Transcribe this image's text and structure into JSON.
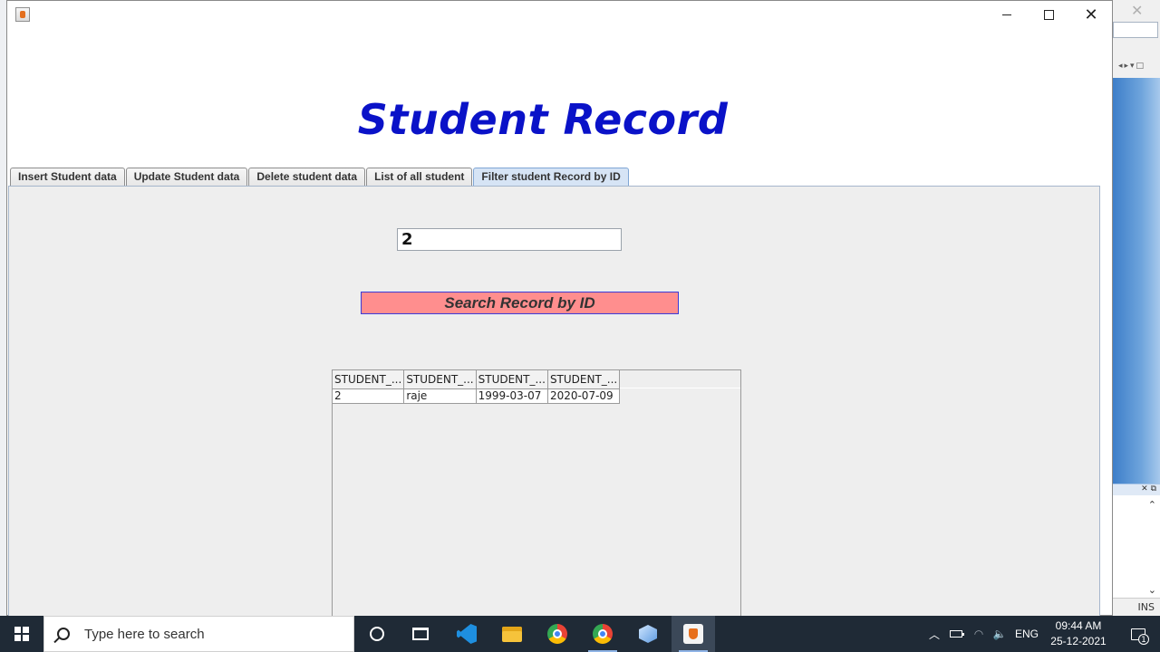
{
  "window": {
    "heading": "Student Record",
    "controls": {
      "minimize": "minimize",
      "maximize": "maximize",
      "close": "close"
    }
  },
  "tabs": [
    {
      "label": "Insert Student data",
      "active": false
    },
    {
      "label": "Update Student data",
      "active": false
    },
    {
      "label": "Delete student data",
      "active": false
    },
    {
      "label": "List of all student",
      "active": false
    },
    {
      "label": "Filter student Record by ID",
      "active": true
    }
  ],
  "filter_panel": {
    "id_input_value": "2",
    "search_button_label": "Search Record by ID",
    "search_button_color": "#ff8e8e",
    "table": {
      "columns": [
        "STUDENT_...",
        "STUDENT_...",
        "STUDENT_...",
        "STUDENT_..."
      ],
      "rows": [
        [
          "2",
          "raje",
          "1999-03-07",
          "2020-07-09"
        ]
      ]
    }
  },
  "background_app": {
    "status": "INS"
  },
  "taskbar": {
    "search_placeholder": "Type here to search",
    "apps": [
      "cortana",
      "task-view",
      "vscode",
      "file-explorer",
      "chrome",
      "chrome-profile",
      "3d-viewer",
      "java"
    ],
    "active_app": "java",
    "tray": {
      "language": "ENG",
      "time": "09:44 AM",
      "date": "25-12-2021",
      "notification_count": "1"
    }
  },
  "colors": {
    "heading": "#0a12c8",
    "taskbar": "#1f2a36",
    "active_tab": "#d6e4f5"
  }
}
